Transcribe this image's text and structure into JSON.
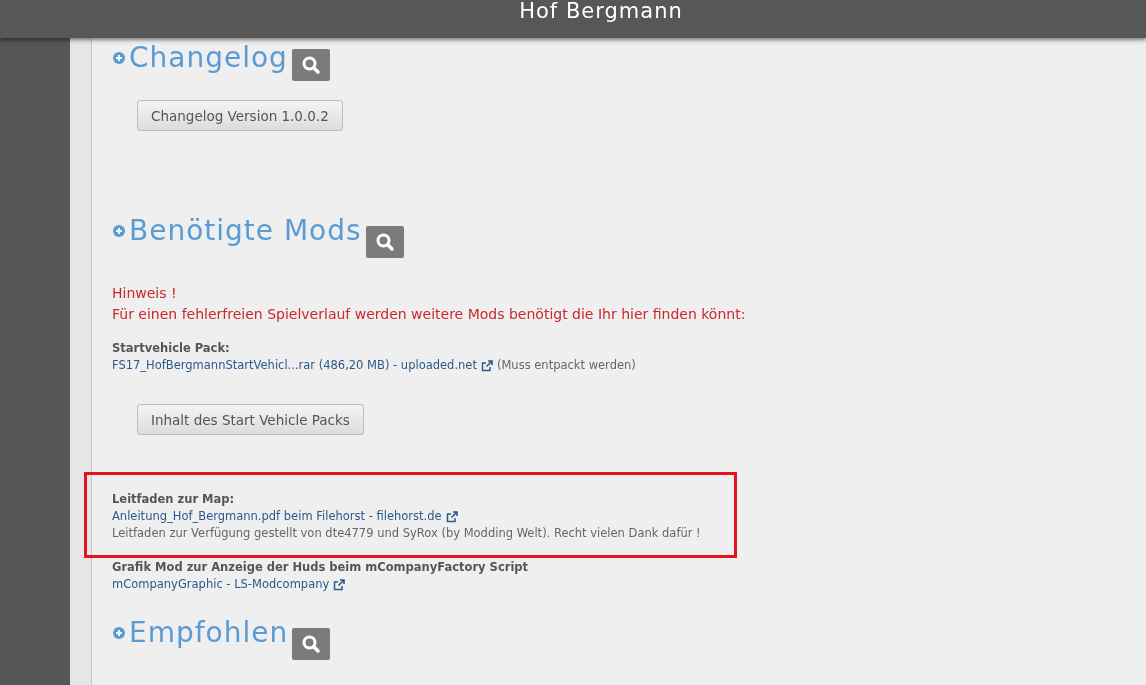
{
  "header": {
    "title": "Hof Bergmann"
  },
  "sections": [
    {
      "title": "Changelog",
      "blocks": [
        {
          "kind": "button",
          "label": "Changelog Version 1.0.0.2"
        }
      ]
    },
    {
      "title": "Benötigte Mods",
      "blocks": [
        {
          "kind": "notice",
          "lines": [
            "Hinweis !",
            "Für einen fehlerfreien Spielverlauf werden weitere Mods benötigt die Ihr hier finden könnt:"
          ]
        },
        {
          "kind": "download",
          "label": "Startvehicle Pack:",
          "link": "FS17_HofBergmannStartVehicl...rar (486,20 MB) - uploaded.net",
          "note": "(Muss entpackt werden)",
          "highlighted": false
        },
        {
          "kind": "button",
          "label": "Inhalt des Start Vehicle Packs"
        },
        {
          "kind": "download",
          "label": "Leitfaden zur Map:",
          "link": "Anleitung_Hof_Bergmann.pdf beim Filehorst - filehorst.de",
          "description": "Leitfaden zur Verfügung gestellt von dte4779 und SyRox (by Modding Welt). Recht vielen Dank dafür !",
          "highlighted": true
        },
        {
          "kind": "download",
          "label": "Grafik Mod zur Anzeige der Huds beim mCompanyFactory Script",
          "link": "mCompanyGraphic - LS-Modcompany",
          "highlighted": false
        }
      ]
    },
    {
      "title": "Empfohlen"
    }
  ]
}
